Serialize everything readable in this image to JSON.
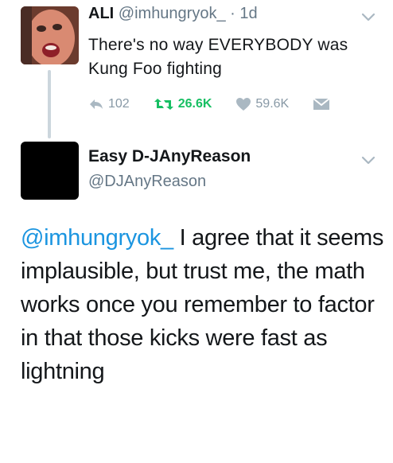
{
  "tweet": {
    "name": "ALI",
    "handle": "@imhungryok_",
    "separator": "·",
    "time": "1d",
    "text": "There's no way EVERYBODY was Kung Foo fighting",
    "replies": "102",
    "retweets": "26.6K",
    "likes": "59.6K",
    "icons": {
      "reply": "reply-icon",
      "retweet": "retweet-icon",
      "like": "heart-icon",
      "dm": "direct-message-icon",
      "more": "chevron-down-icon"
    }
  },
  "reply": {
    "name": "Easy D-JAnyReason",
    "handle": "@DJAnyReason",
    "mention": "@imhungryok_",
    "text": " I agree that it seems implausible, but trust me, the math works once you remember to factor in that those kicks were fast as lightning"
  },
  "colors": {
    "link": "#1b95e0",
    "retweet": "#17bf63",
    "muted": "#8899a6",
    "thread": "#ccd6dd"
  }
}
